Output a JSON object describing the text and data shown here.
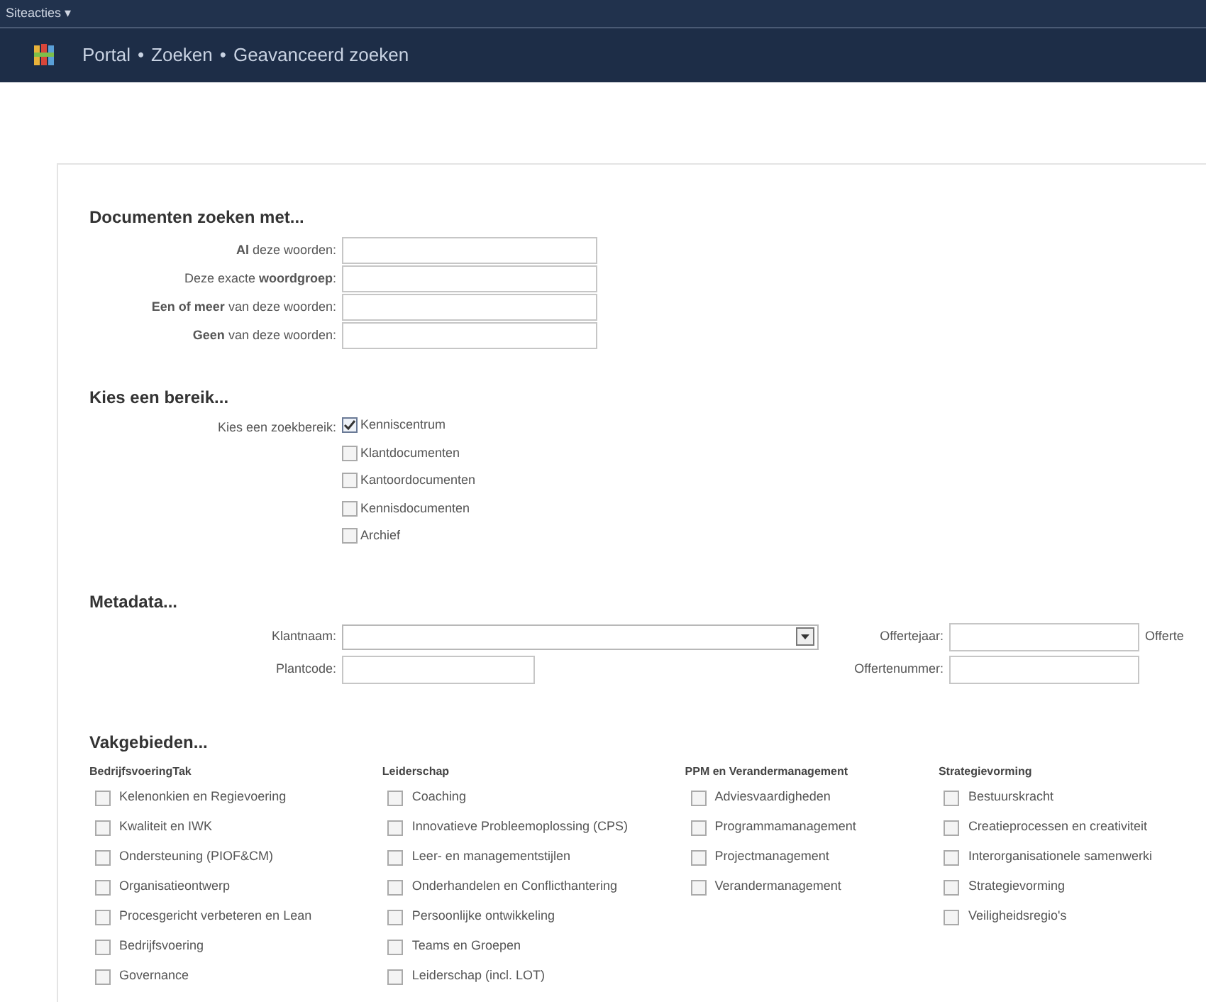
{
  "top_bar": {
    "menu": "Siteacties ▾"
  },
  "breadcrumb": [
    "Portal",
    "Zoeken",
    "Geavanceerd zoeken"
  ],
  "breadcrumb_separator": "•",
  "documents": {
    "heading": "Documenten zoeken met...",
    "fields": [
      {
        "label": "**Al** deze woorden:"
      },
      {
        "label": "Deze exacte **woordgroep**:"
      },
      {
        "label": "**Een of meer** van deze woorden:"
      },
      {
        "label": "**Geen** van deze woorden:"
      }
    ]
  },
  "scope": {
    "heading": "Kies een bereik...",
    "label": "Kies een zoekbereik:",
    "options": [
      {
        "label": "Kenniscentrum",
        "checked": true
      },
      {
        "label": "Klantdocumenten",
        "checked": false
      },
      {
        "label": "Kantoordocumenten",
        "checked": false
      },
      {
        "label": "Kennisdocumenten",
        "checked": false
      },
      {
        "label": "Archief",
        "checked": false
      }
    ]
  },
  "metadata": {
    "heading": "Metadata...",
    "rows": [
      [
        {
          "label": "Klantnaam:",
          "kind": "select"
        },
        {
          "label": "Offertejaar:",
          "kind": "input"
        },
        {
          "label": "Offerte",
          "kind": "label"
        }
      ],
      [
        {
          "label": "Plantcode:",
          "kind": "input"
        },
        {
          "label": "Offertenummer:",
          "kind": "input"
        }
      ]
    ]
  },
  "areas": {
    "heading": "Vakgebieden...",
    "columns": [
      {
        "title": "BedrijfsvoeringTak",
        "items": [
          {
            "label": "Kelenonkien en Regievoering",
            "checked": false
          },
          {
            "label": "Kwaliteit en IWK",
            "checked": false
          },
          {
            "label": "Ondersteuning (PIOF&CM)",
            "checked": false
          },
          {
            "label": "Organisatieontwerp",
            "checked": false
          },
          {
            "label": "Procesgericht verbeteren en Lean",
            "checked": false
          },
          {
            "label": "Bedrijfsvoering",
            "checked": false
          },
          {
            "label": "Governance",
            "checked": false
          }
        ]
      },
      {
        "title": "Leiderschap",
        "items": [
          {
            "label": "Coaching",
            "checked": false
          },
          {
            "label": "Innovatieve Probleemoplossing (CPS)",
            "checked": false
          },
          {
            "label": "Leer- en managementstijlen",
            "checked": false
          },
          {
            "label": "Onderhandelen en Conflicthantering",
            "checked": false
          },
          {
            "label": "Persoonlijke ontwikkeling",
            "checked": false
          },
          {
            "label": "Teams en Groepen",
            "checked": false
          },
          {
            "label": "Leiderschap (incl. LOT)",
            "checked": false
          }
        ]
      },
      {
        "title": "PPM en Verandermanagement",
        "items": [
          {
            "label": "Adviesvaardigheden",
            "checked": false
          },
          {
            "label": "Programmamanagement",
            "checked": false
          },
          {
            "label": "Projectmanagement",
            "checked": false
          },
          {
            "label": "Verandermanagement",
            "checked": false
          }
        ]
      },
      {
        "title": "Strategievorming",
        "items": [
          {
            "label": "Bestuurskracht",
            "checked": false
          },
          {
            "label": "Creatieprocessen en creativiteit",
            "checked": false
          },
          {
            "label": "Interorganisationele samenwerki",
            "checked": false
          },
          {
            "label": "Strategievorming",
            "checked": false
          },
          {
            "label": "Veiligheidsregio's",
            "checked": false
          }
        ]
      }
    ]
  }
}
